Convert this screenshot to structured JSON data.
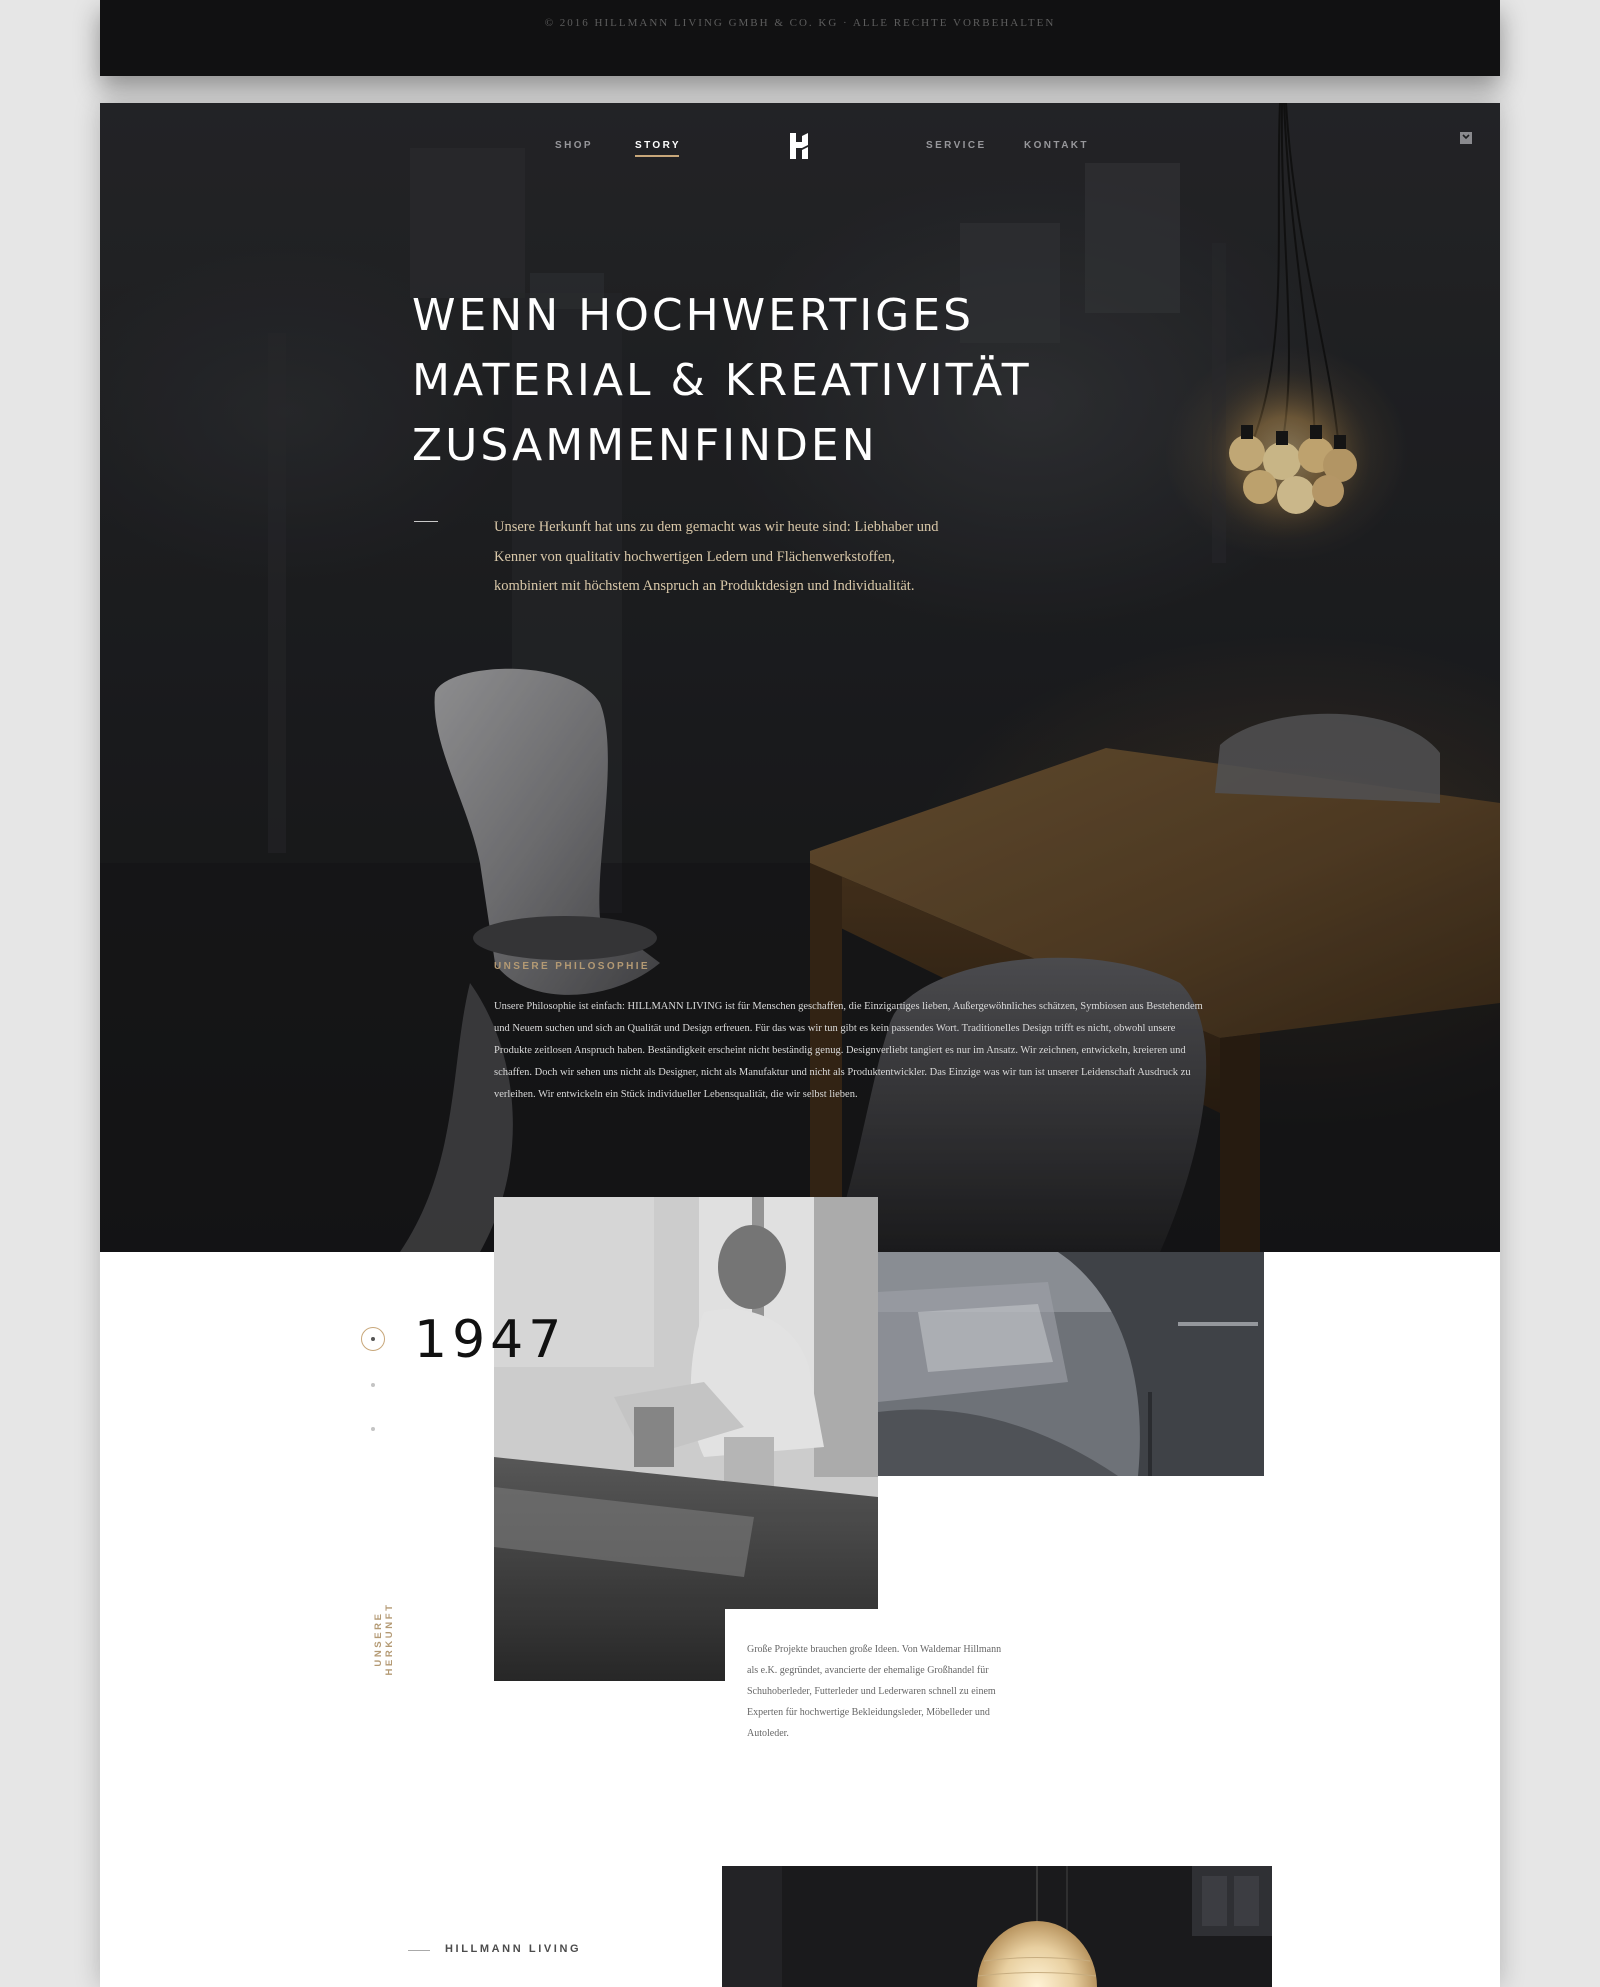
{
  "footer": {
    "copyright": "© 2016 HILLMANN LIVING GMBH & CO. KG · ALLE RECHTE VORBEHALTEN"
  },
  "nav": {
    "shop": "SHOP",
    "story": "STORY",
    "service": "SERVICE",
    "kontakt": "KONTAKT",
    "active": "STORY"
  },
  "hero": {
    "title": "WENN HOCHWERTIGES\nMATERIAL & KREATIVITÄT\nZUSAMMENFINDEN",
    "intro": "Unsere Herkunft hat uns zu dem gemacht was wir heute sind: Liebhaber und Kenner von qualitativ hochwertigen Ledern und Flächenwerkstoffen, kombiniert mit höchstem Anspruch an Produktdesign und Individualität."
  },
  "philosophy": {
    "label": "UNSERE PHILOSOPHIE",
    "text": "Unsere Philosophie ist einfach: HILLMANN LIVING ist für Menschen geschaffen, die Einzigartiges lieben, Außergewöhnliches schätzen, Symbiosen aus Bestehendem und Neuem suchen und sich an Qualität und Design erfreuen. Für das was wir tun gibt es kein passendes Wort. Traditionelles Design trifft es nicht, obwohl unsere Produkte zeitlosen Anspruch haben. Beständigkeit erscheint nicht beständig genug. Designverliebt tangiert es nur im Ansatz. Wir zeichnen, entwickeln, kreieren und schaffen. Doch wir sehen uns nicht als Designer, nicht als Manufaktur und nicht als Produktentwickler. Das Einzige was wir tun ist unserer Leidenschaft Ausdruck zu verleihen. Wir entwickeln ein Stück individueller Lebensqualität, die wir selbst lieben."
  },
  "timeline": {
    "year": "1947",
    "section_label": "UNSERE HERKUNFT",
    "text": "Große Projekte brauchen große Ideen. Von Waldemar Hillmann als e.K. gegründet, avancierte der ehemalige Großhandel für Schuhoberleder, Futterleder und Lederwaren schnell zu einem Experten für hochwertige Bekleidungsleder, Möbelleder und Autoleder."
  },
  "brand": {
    "label": "HILLMANN LIVING"
  },
  "colors": {
    "accent_gold": "#c8a77a",
    "hero_dark": "#1d1e20",
    "footer_bg": "#111112"
  }
}
